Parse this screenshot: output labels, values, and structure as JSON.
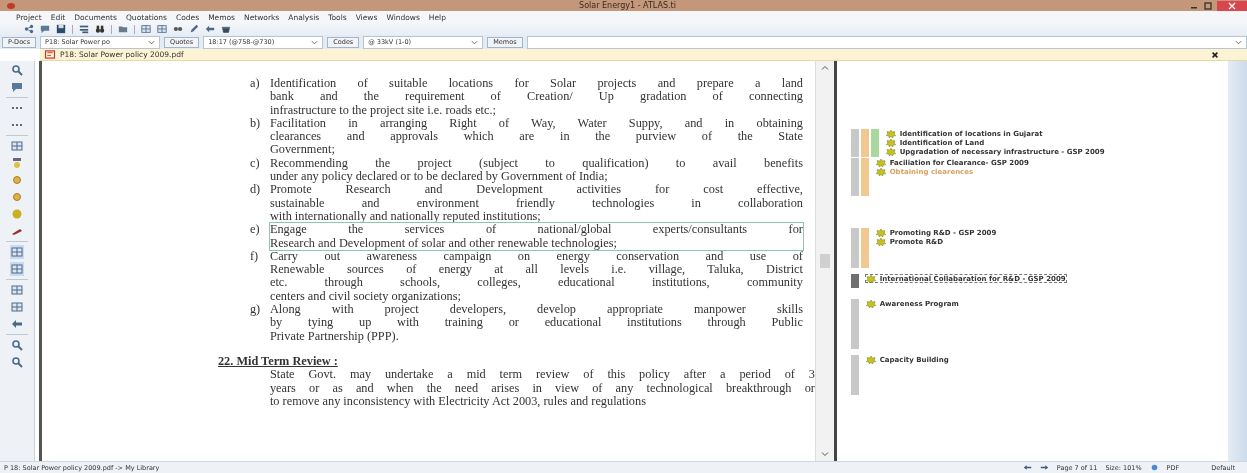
{
  "window": {
    "title": "Solar Energy1 - ATLAS.ti"
  },
  "menu": [
    "Project",
    "Edit",
    "Documents",
    "Quotations",
    "Codes",
    "Memos",
    "Networks",
    "Analysis",
    "Tools",
    "Views",
    "Windows",
    "Help"
  ],
  "selectors": [
    {
      "button": "P-Docs",
      "value": "P18: Solar Power po"
    },
    {
      "button": "Quotes",
      "value": "18:17 (@758-@730)"
    },
    {
      "button": "Codes",
      "value": "@ 33kV (1-0)"
    },
    {
      "button": "Memos"
    }
  ],
  "document_tab": {
    "title": "P18: Solar Power policy 2009.pdf"
  },
  "document": {
    "items": [
      {
        "label": "a)",
        "selected": false,
        "lines": [
          "Identification of suitable locations for Solar projects and prepare a land",
          "bank and  the requirement of Creation/ Up gradation of connecting",
          "infrastructure to the project site i.e. roads etc.;"
        ]
      },
      {
        "label": "b)",
        "selected": false,
        "lines": [
          "Facilitation in arranging Right of Way, Water Suppy, and in obtaining",
          "clearances and approvals which are in the purview of the State",
          "Government;"
        ]
      },
      {
        "label": "c)",
        "selected": false,
        "lines": [
          "Recommending the project (subject to qualification) to avail benefits",
          "under any policy declared or to be declared by Government of India;"
        ]
      },
      {
        "label": "d)",
        "selected": false,
        "lines": [
          "Promote Research and Development activities for cost effective,",
          "sustainable and environment friendly technologies in collaboration",
          "with internationally and nationally reputed institutions;"
        ]
      },
      {
        "label": "e)",
        "selected": true,
        "lines": [
          "Engage the services of national/global experts/consultants for",
          "Research and Development of solar and other renewable technologies;"
        ]
      },
      {
        "label": "f)",
        "selected": false,
        "lines": [
          "Carry out awareness campaign on energy conservation and use of",
          "Renewable sources of energy at all levels i.e. village, Taluka, District",
          "etc. through schools, colleges, educational institutions, community",
          "centers and civil society organizations;"
        ]
      },
      {
        "label": "g)",
        "selected": false,
        "lines": [
          "Along with project developers, develop appropriate manpower skills",
          "by tying up with training or educational institutions through Public",
          "Private Partnership (PPP)."
        ]
      }
    ],
    "heading": "22. Mid Term Review :",
    "paragraph": [
      "State Govt. may undertake a mid term review of this policy after a period of 3",
      "years or as and when the need arises in view of any technological breakthrough or",
      "to remove any inconsistency with Electricity Act 2003, rules and regulations"
    ]
  },
  "margin": {
    "groups": [
      {
        "bars": [
          {
            "color": "#c8c8c8"
          },
          {
            "color": "#f0c890"
          },
          {
            "color": "#a8d8a0"
          }
        ],
        "codes": [
          {
            "name": "Identification of locations in Gujarat",
            "color": "#333333",
            "selected": false
          },
          {
            "name": "Identification of Land",
            "color": "#333333",
            "selected": false
          },
          {
            "name": "Upgradation of necessary infrastructure - GSP 2009",
            "color": "#333333",
            "selected": false
          }
        ]
      },
      {
        "bars": [
          {
            "color": "#c8c8c8"
          },
          {
            "color": "#f0c890"
          }
        ],
        "codes": [
          {
            "name": "Faciliation for Clearance- GSP 2009",
            "color": "#333333",
            "selected": false
          },
          {
            "name": "Obtaining clearences",
            "color": "#d9a060",
            "selected": false
          }
        ]
      },
      {
        "bars": [
          {
            "color": "#c8c8c8"
          },
          {
            "color": "#f0c890"
          }
        ],
        "codes": [
          {
            "name": "Promoting R&D - GSP 2009",
            "color": "#333333",
            "selected": false
          },
          {
            "name": "Promote R&D",
            "color": "#333333",
            "selected": false
          }
        ]
      },
      {
        "bars": [
          {
            "color": "#707070"
          }
        ],
        "codes": [
          {
            "name": "International Collabaration for R&D - GSP 2009",
            "color": "#333333",
            "selected": true
          }
        ]
      },
      {
        "bars": [
          {
            "color": "#c8c8c8"
          }
        ],
        "codes": [
          {
            "name": "Awareness Program",
            "color": "#333333",
            "selected": false
          }
        ]
      },
      {
        "bars": [
          {
            "color": "#c8c8c8"
          }
        ],
        "codes": [
          {
            "name": "Capacity Building",
            "color": "#333333",
            "selected": false
          }
        ]
      }
    ]
  },
  "status_bar": {
    "path": "P 18: Solar Power policy 2009.pdf -> My Library",
    "page": "Page 7 of 11",
    "size": "Size: 101%",
    "format": "PDF",
    "mode": "Default"
  }
}
